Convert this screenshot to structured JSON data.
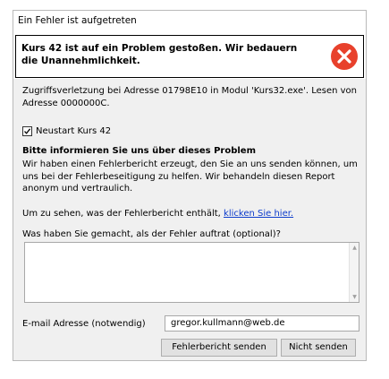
{
  "window": {
    "title": "Ein Fehler ist aufgetreten"
  },
  "banner": {
    "text": "Kurs 42 ist auf ein Problem gestoßen. Wir bedauern die Unannehmlichkeit.",
    "icon": "error-x-icon",
    "icon_color": "#e8412c"
  },
  "message": "Zugriffsverletzung bei Adresse 01798E10 in Modul 'Kurs32.exe'. Lesen von Adresse 0000000C.",
  "restart": {
    "label": "Neustart Kurs 42",
    "checked": true
  },
  "report": {
    "heading": "Bitte informieren Sie uns über dieses Problem",
    "body": "Wir haben einen Fehlerbericht erzeugt, den Sie an uns senden können, um uns bei der Fehlerbeseitigung zu helfen. Wir behandeln diesen Report anonym und vertraulich.",
    "link_prefix": "Um zu sehen, was der Fehlerbericht enthält,",
    "link_label": "klicken Sie hier."
  },
  "question": {
    "label": "Was haben Sie gemacht, als der Fehler auftrat (optional)?",
    "value": ""
  },
  "email": {
    "label": "E-mail Adresse (notwendig)",
    "value": "gregor.kullmann@web.de"
  },
  "buttons": {
    "send": "Fehlerbericht senden",
    "dont_send": "Nicht senden"
  }
}
